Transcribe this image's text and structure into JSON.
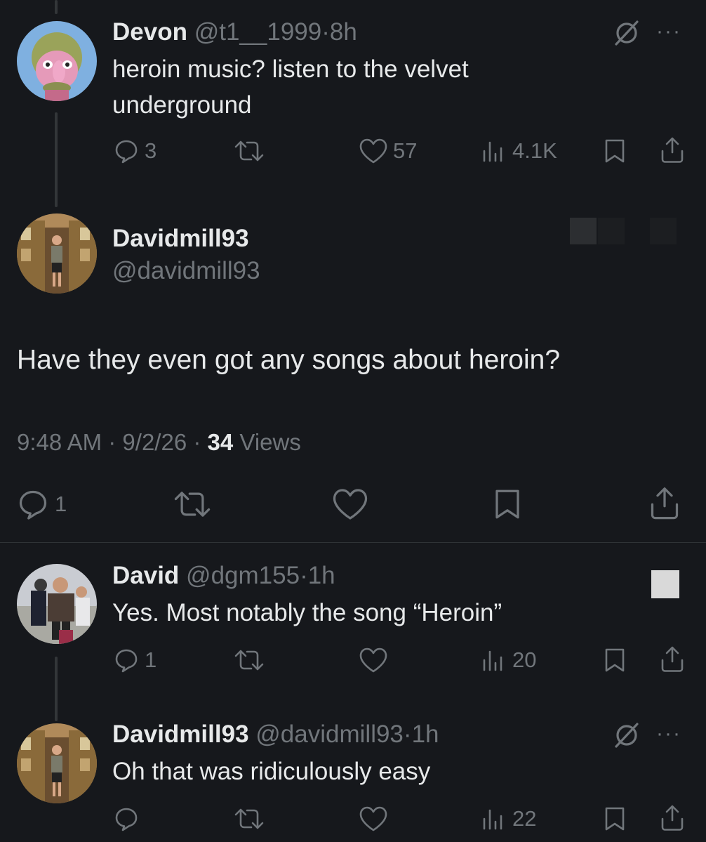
{
  "colors": {
    "background": "#16181c",
    "text": "#e7e9ea",
    "muted": "#71767b",
    "divider": "#2f3336"
  },
  "posts": [
    {
      "name": "Devon",
      "handle": "@t1__1999",
      "sep": "·",
      "time": "8h",
      "text": "heroin music?  listen to the velvet underground",
      "replies": "3",
      "likes": "57",
      "views": "4.1K",
      "grok_icon": "grok-icon",
      "more": "···"
    },
    {
      "name": "David",
      "handle": "@dgm155",
      "sep": "·",
      "time": "1h",
      "text": "Yes. Most notably the song “Heroin”",
      "replies": "1",
      "views": "20"
    },
    {
      "name": "Davidmill93",
      "handle": "@davidmill93",
      "sep": "·",
      "time": "1h",
      "text": "Oh that was ridiculously easy",
      "views": "22",
      "grok_icon": "grok-icon",
      "more": "···"
    }
  ],
  "main_post": {
    "name": "Davidmill93",
    "handle": "@davidmill93",
    "text": "Have they even got any songs about heroin?",
    "time": "9:48 AM",
    "sep1": "·",
    "date": "9/2/26",
    "sep2": "·",
    "views_count": "34",
    "views_label": " Views",
    "replies": "1"
  }
}
